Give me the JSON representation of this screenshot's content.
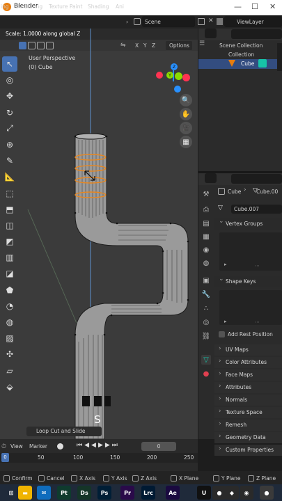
{
  "window": {
    "title": "Blender",
    "controls": [
      "—",
      "☐",
      "✕"
    ]
  },
  "workspaces": [
    "ing",
    "UV Editing",
    "Texture Paint",
    "Shading",
    "Ani"
  ],
  "scene": {
    "label": "Scene"
  },
  "viewlayer": {
    "label": "ViewLayer"
  },
  "operator": {
    "status": "Scale: 1.0000 along global Z"
  },
  "viewport": {
    "view_name": "User Perspective",
    "object_name": "(0) Cube",
    "axes": [
      "X",
      "Y",
      "Z"
    ],
    "options_label": "Options",
    "redo_panel_label": "Loop Cut and Slide",
    "key_overlay": "S",
    "gizmo_labels": {
      "z": "Z",
      "y": "Y",
      "x": "X"
    },
    "axis_colors": {
      "x": "#ff3352",
      "y": "#8bdc00",
      "z": "#2890ff"
    },
    "edge_select_color": "#e8871f"
  },
  "outliner": {
    "scene_collection": "Scene Collection",
    "collection": "Collection",
    "object": "Cube"
  },
  "properties": {
    "breadcrumb_object": "Cube",
    "breadcrumb_data": "Cube.00",
    "mesh_name": "Cube.007",
    "vertex_groups": "Vertex Groups",
    "shape_keys": "Shape Keys",
    "add_rest_position": "Add Rest Position",
    "sections": [
      "UV Maps",
      "Color Attributes",
      "Face Maps",
      "Attributes",
      "Normals",
      "Texture Space",
      "Remesh",
      "Geometry Data",
      "Custom Properties"
    ]
  },
  "timeline": {
    "menu_view": "View",
    "menu_marker": "Marker",
    "current_frame": "0",
    "ticks": [
      "0",
      "50",
      "100",
      "150",
      "200",
      "250"
    ]
  },
  "statusbar": {
    "hints": [
      "Confirm",
      "Cancel",
      "X Axis",
      "Y Axis",
      "Z Axis",
      "X Plane",
      "Y Plane",
      "Z Plane"
    ]
  },
  "taskbar": {
    "apps": [
      {
        "icon": "windows-icon",
        "label": "⊞",
        "color": "#1f2a3a"
      },
      {
        "icon": "file-explorer-icon",
        "label": "▬",
        "color": "#f0b400"
      },
      {
        "icon": "mail-icon",
        "label": "✉",
        "color": "#0f6cbd"
      },
      {
        "icon": "premiere-pro-icon",
        "label": "Pt",
        "color": "#0f3b2e"
      },
      {
        "icon": "dreamweaver-icon",
        "label": "Ds",
        "color": "#153528"
      },
      {
        "icon": "photoshop-icon",
        "label": "Ps",
        "color": "#001e36"
      },
      {
        "icon": "premiere-icon",
        "label": "Pr",
        "color": "#2a0a4a"
      },
      {
        "icon": "lightroom-icon",
        "label": "Lrc",
        "color": "#001a33"
      },
      {
        "icon": "after-effects-icon",
        "label": "Ae",
        "color": "#1a0a40"
      },
      {
        "icon": "unreal-icon",
        "label": "U",
        "color": "#111111"
      },
      {
        "icon": "blender-taskbar-icon",
        "label": "●",
        "color": "#2a2a2a"
      },
      {
        "icon": "vpn-icon",
        "label": "◆",
        "color": "#2a2a2a"
      },
      {
        "icon": "chrome-icon",
        "label": "◉",
        "color": "#2a2a2a"
      },
      {
        "icon": "blender-active-icon",
        "label": "●",
        "color": "#3a3a3a"
      }
    ]
  }
}
